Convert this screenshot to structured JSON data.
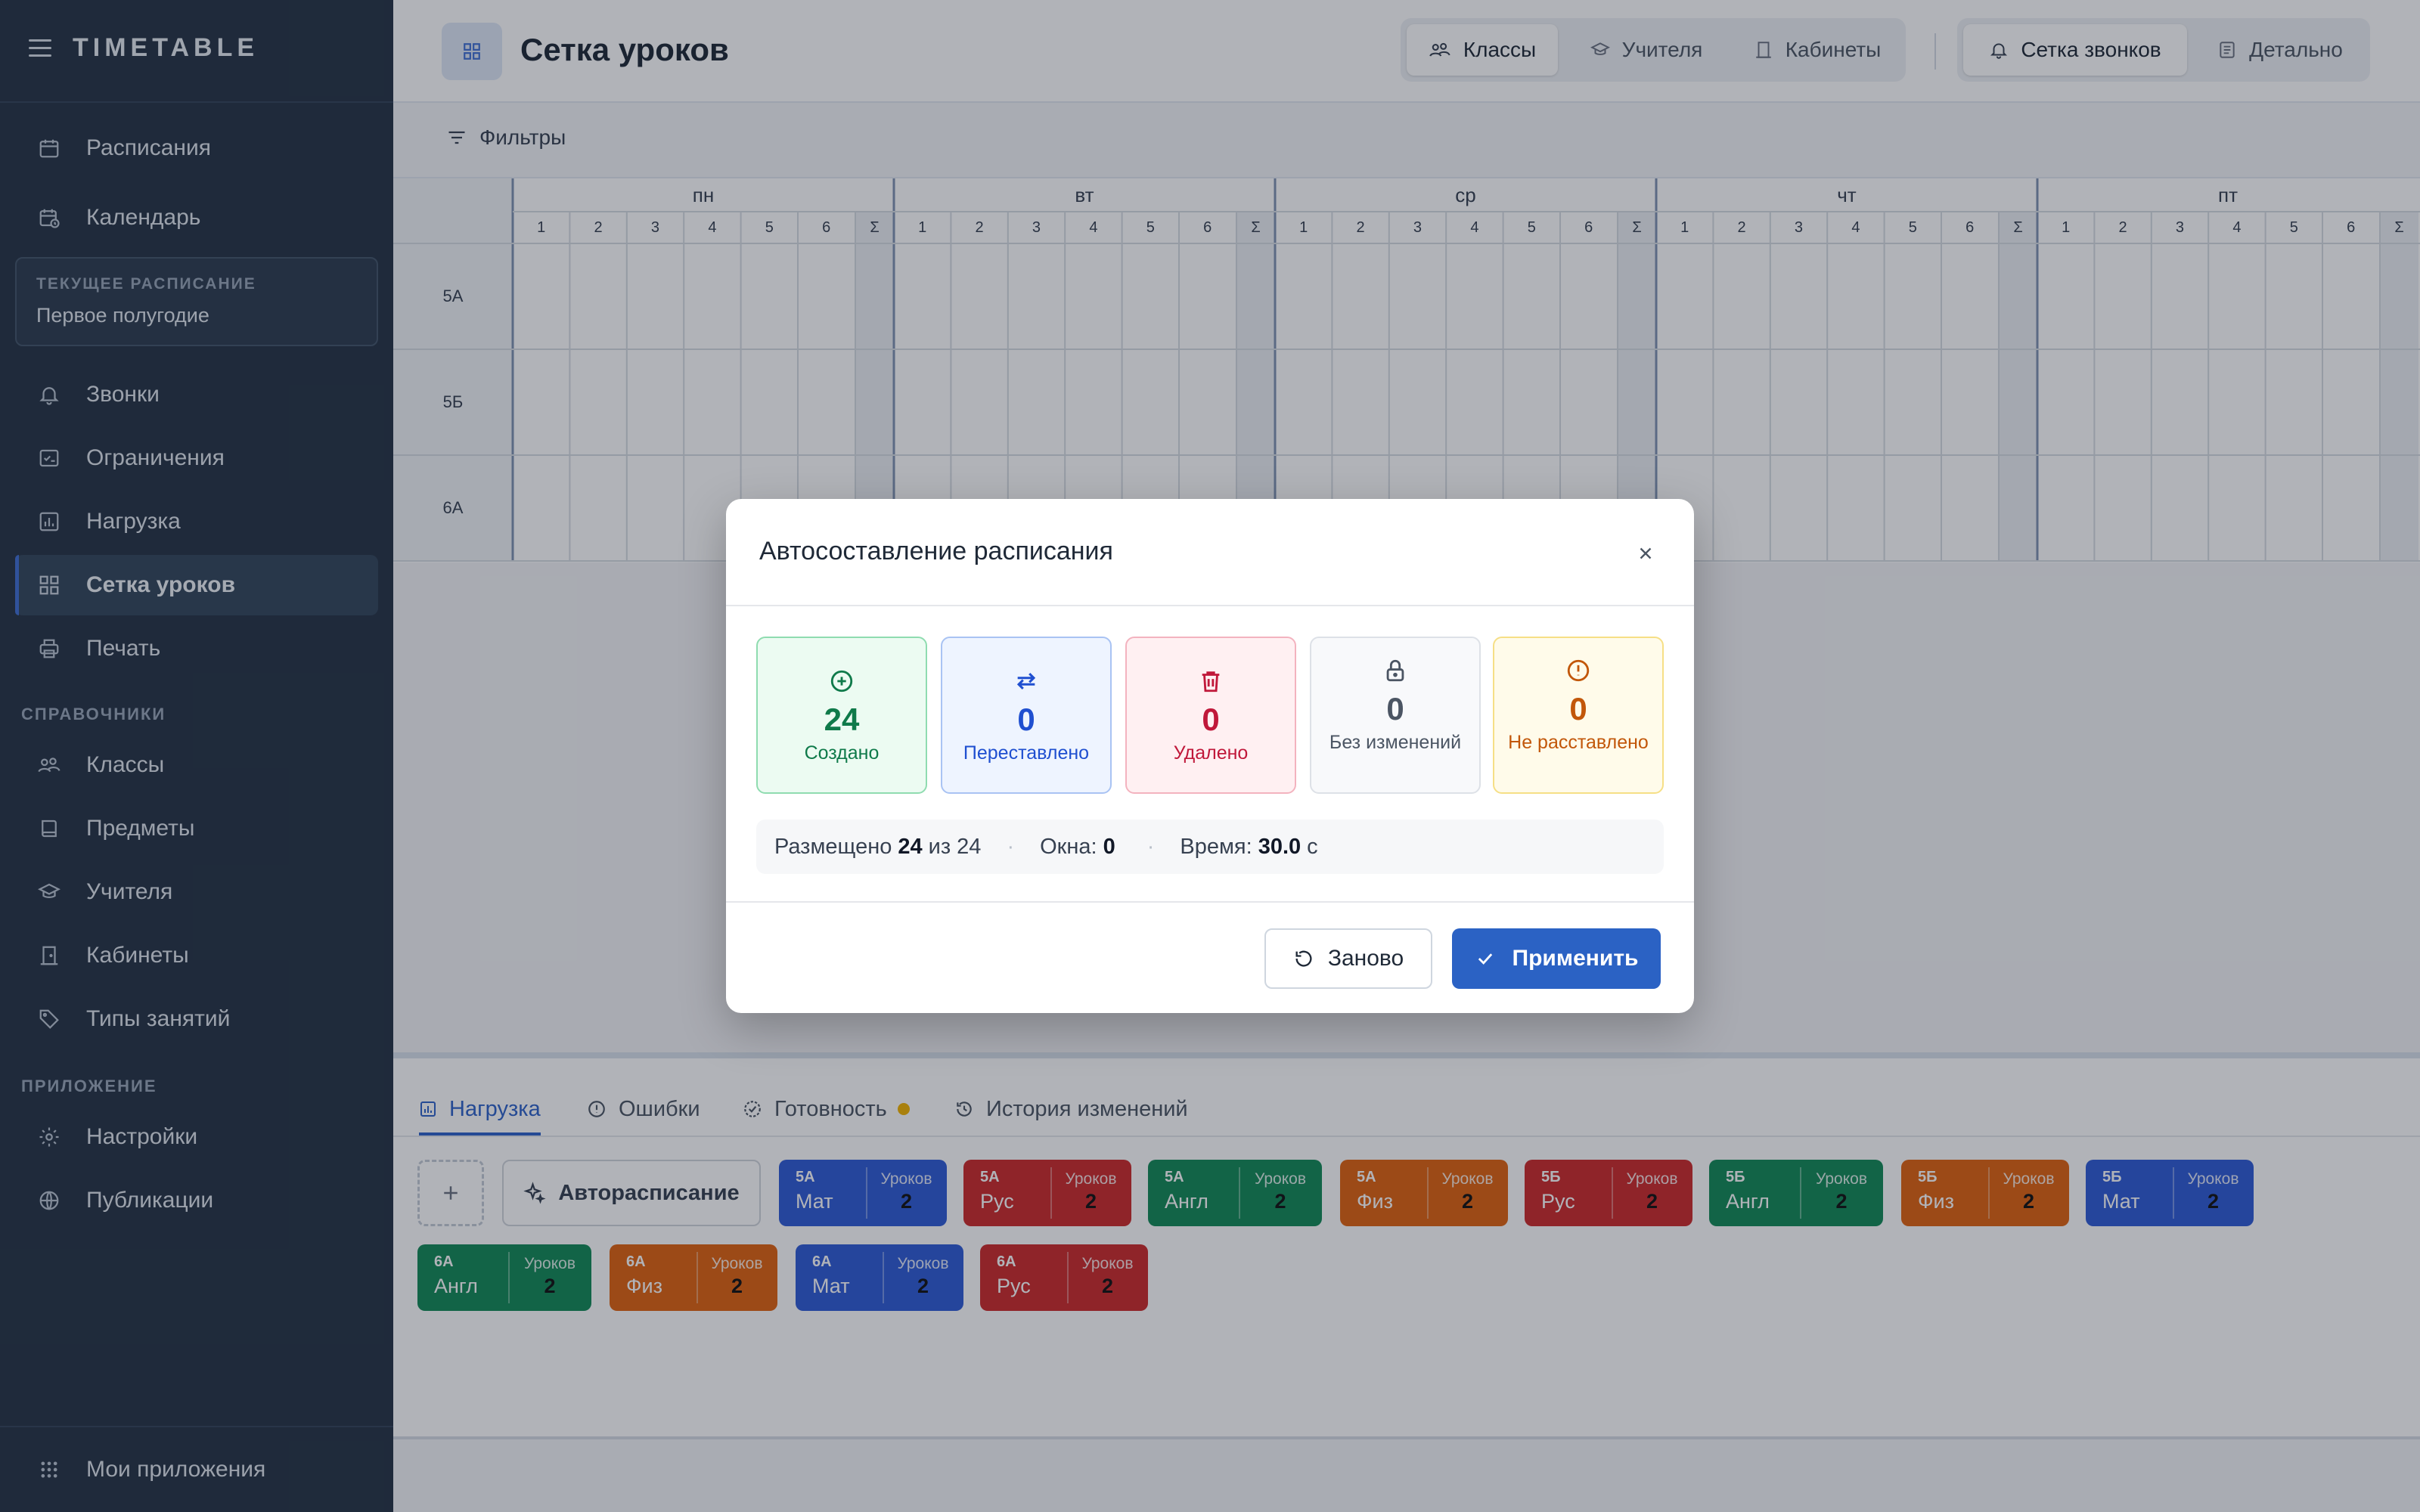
{
  "app": {
    "brand": "TIMETABLE"
  },
  "sidebar": {
    "items_top": [
      {
        "label": "Расписания",
        "icon": "calendar-icon"
      },
      {
        "label": "Календарь",
        "icon": "calendar-clock-icon"
      }
    ],
    "current": {
      "title": "ТЕКУЩЕЕ РАСПИСАНИЕ",
      "value": "Первое полугодие"
    },
    "items_main": [
      {
        "label": "Звонки",
        "icon": "bell-icon"
      },
      {
        "label": "Ограничения",
        "icon": "checklist-icon"
      },
      {
        "label": "Нагрузка",
        "icon": "bar-chart-icon"
      },
      {
        "label": "Сетка уроков",
        "icon": "grid-icon",
        "active": true
      },
      {
        "label": "Печать",
        "icon": "printer-icon"
      }
    ],
    "section_ref": "СПРАВОЧНИКИ",
    "items_ref": [
      {
        "label": "Классы",
        "icon": "classes-icon"
      },
      {
        "label": "Предметы",
        "icon": "book-icon"
      },
      {
        "label": "Учителя",
        "icon": "graduation-cap-icon"
      },
      {
        "label": "Кабинеты",
        "icon": "door-icon"
      },
      {
        "label": "Типы занятий",
        "icon": "tag-icon"
      }
    ],
    "section_app": "ПРИЛОЖЕНИЕ",
    "items_app": [
      {
        "label": "Настройки",
        "icon": "gear-icon"
      },
      {
        "label": "Публикации",
        "icon": "globe-icon"
      }
    ],
    "footer": "Мои приложения"
  },
  "header": {
    "title": "Сетка уроков",
    "view_tabs": [
      {
        "label": "Классы",
        "active": true
      },
      {
        "label": "Учителя",
        "active": false
      },
      {
        "label": "Кабинеты",
        "active": false
      }
    ],
    "mode_tabs": [
      {
        "label": "Сетка звонков",
        "active": true
      },
      {
        "label": "Детально",
        "active": false
      }
    ]
  },
  "filter": {
    "label": "Фильтры"
  },
  "timetable": {
    "days": [
      "пн",
      "вт",
      "ср",
      "чт",
      "пт"
    ],
    "periods": [
      "1",
      "2",
      "3",
      "4",
      "5",
      "6"
    ],
    "sum_label": "Σ",
    "classes": [
      "5А",
      "5Б",
      "6А"
    ]
  },
  "bottom": {
    "tabs": [
      {
        "label": "Нагрузка",
        "active": true
      },
      {
        "label": "Ошибки"
      },
      {
        "label": "Готовность",
        "badge": true
      },
      {
        "label": "История изменений"
      }
    ],
    "auto_label": "Авторасписание",
    "lessons_label": "Уроков",
    "chips": [
      {
        "cls": "5А",
        "subj": "Мат",
        "count": "2",
        "color": "#2f5bd6"
      },
      {
        "cls": "5А",
        "subj": "Рус",
        "count": "2",
        "color": "#cc2b2b"
      },
      {
        "cls": "5А",
        "subj": "Англ",
        "count": "2",
        "color": "#138a57"
      },
      {
        "cls": "5А",
        "subj": "Физ",
        "count": "2",
        "color": "#e0630f"
      },
      {
        "cls": "5Б",
        "subj": "Рус",
        "count": "2",
        "color": "#cc2b2b"
      },
      {
        "cls": "5Б",
        "subj": "Англ",
        "count": "2",
        "color": "#138a57"
      },
      {
        "cls": "5Б",
        "subj": "Физ",
        "count": "2",
        "color": "#e0630f"
      },
      {
        "cls": "5Б",
        "subj": "Мат",
        "count": "2",
        "color": "#2f5bd6"
      },
      {
        "cls": "6А",
        "subj": "Англ",
        "count": "2",
        "color": "#138a57"
      },
      {
        "cls": "6А",
        "subj": "Физ",
        "count": "2",
        "color": "#e0630f"
      },
      {
        "cls": "6А",
        "subj": "Мат",
        "count": "2",
        "color": "#2f5bd6"
      },
      {
        "cls": "6А",
        "subj": "Рус",
        "count": "2",
        "color": "#cc2b2b"
      }
    ]
  },
  "modal": {
    "title": "Автосоставление расписания",
    "stats": [
      {
        "value": "24",
        "label": "Создано",
        "icon": "plus-circle-icon",
        "color": "#0f7a4a",
        "bg": "#ecfbf2",
        "border": "#8fdcb0"
      },
      {
        "value": "0",
        "label": "Переставлено",
        "icon": "swap-arrows-icon",
        "color": "#1f4fd0",
        "bg": "#eef4ff",
        "border": "#a9c3f3"
      },
      {
        "value": "0",
        "label": "Удалено",
        "icon": "trash-icon",
        "color": "#c0183a",
        "bg": "#fff0f2",
        "border": "#f3b3bf"
      },
      {
        "value": "0",
        "label": "Без изменений",
        "icon": "lock-icon",
        "color": "#4b5563",
        "bg": "#f8f9fb",
        "border": "#dde1e7"
      },
      {
        "value": "0",
        "label": "Не расставлено",
        "icon": "alert-circle-icon",
        "color": "#c2570a",
        "bg": "#fffbea",
        "border": "#f6df86"
      }
    ],
    "summary": {
      "placed_label": "Размещено",
      "placed": "24",
      "of_label": "из 24",
      "gaps_label": "Окна:",
      "gaps": "0",
      "time_label": "Время:",
      "time": "30.0",
      "time_unit": "с"
    },
    "redo_label": "Заново",
    "apply_label": "Применить"
  }
}
